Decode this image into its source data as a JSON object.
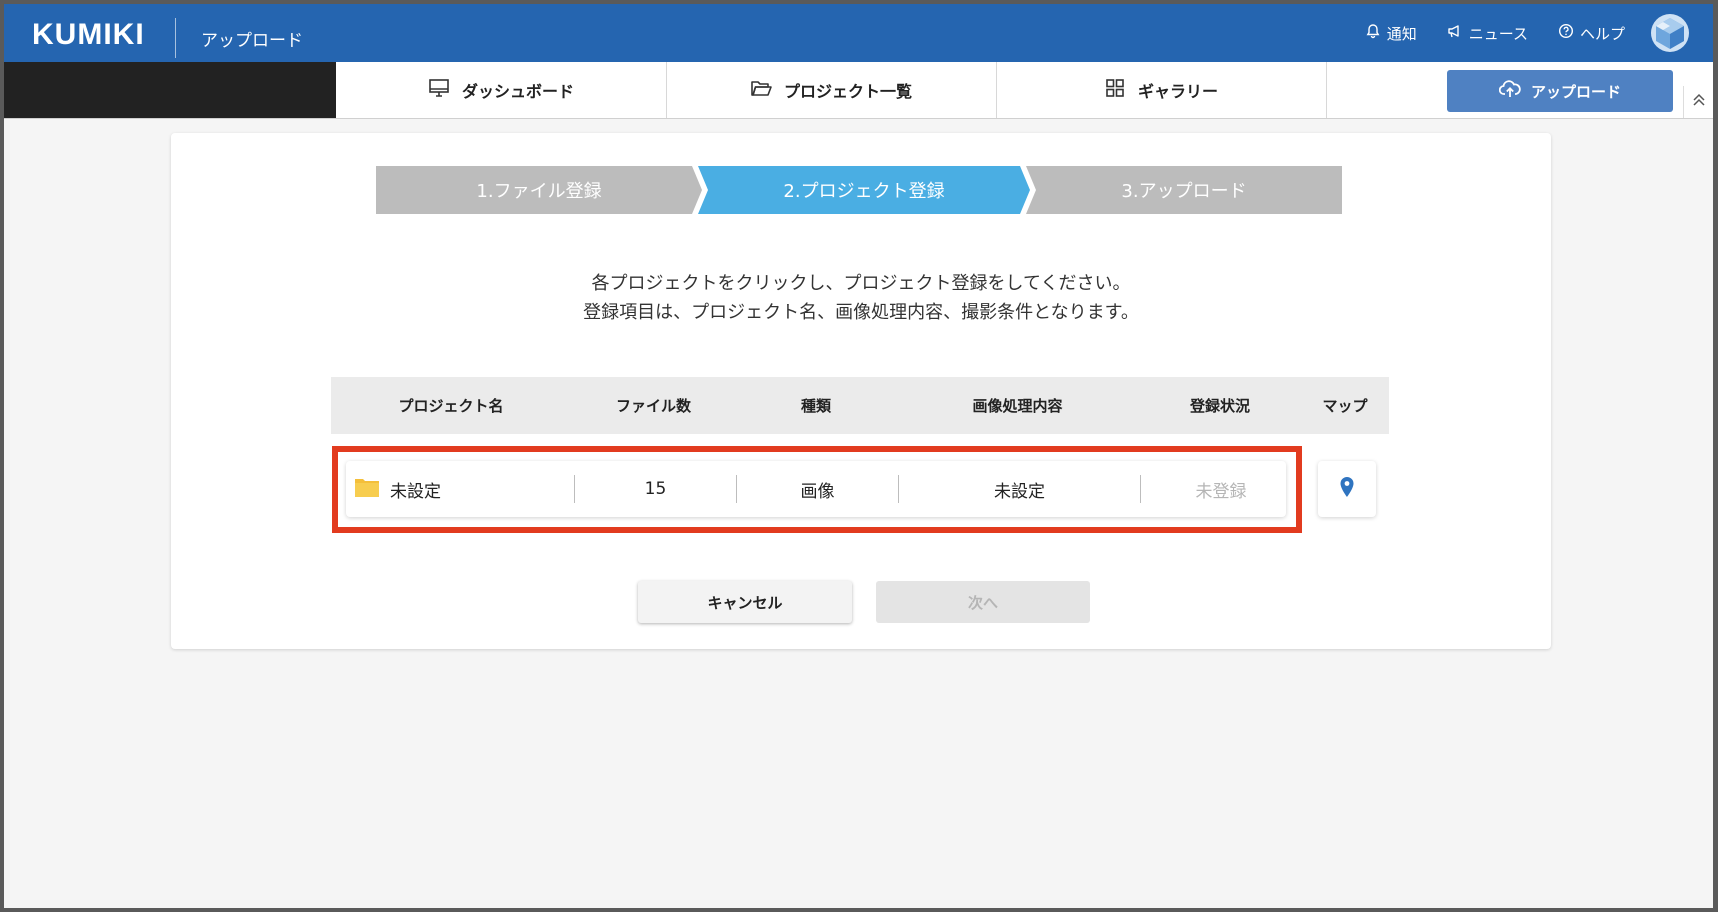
{
  "header": {
    "logo": "KUMIKI",
    "page_name": "アップロード",
    "notify_label": "通知",
    "news_label": "ニュース",
    "help_label": "ヘルプ"
  },
  "nav": {
    "tabs": [
      {
        "label": "ダッシュボード",
        "icon": "monitor-icon"
      },
      {
        "label": "プロジェクト一覧",
        "icon": "folder-icon"
      },
      {
        "label": "ギャラリー",
        "icon": "grid-icon"
      }
    ],
    "upload_label": "アップロード"
  },
  "steps": [
    {
      "label": "1.ファイル登録",
      "active": false
    },
    {
      "label": "2.プロジェクト登録",
      "active": true
    },
    {
      "label": "3.アップロード",
      "active": false
    }
  ],
  "instructions": {
    "line1": "各プロジェクトをクリックし、プロジェクト登録をしてください。",
    "line2": "登録項目は、プロジェクト名、画像処理内容、撮影条件となります。"
  },
  "table": {
    "headers": {
      "name": "プロジェクト名",
      "files": "ファイル数",
      "type": "種類",
      "processing": "画像処理内容",
      "status": "登録状況",
      "map": "マップ"
    },
    "rows": [
      {
        "name": "未設定",
        "files": "15",
        "type": "画像",
        "processing": "未設定",
        "status": "未登録"
      }
    ]
  },
  "buttons": {
    "cancel": "キャンセル",
    "next": "次へ"
  },
  "colors": {
    "header_bg": "#2565b0",
    "step_active": "#4aaee3",
    "step_inactive": "#bcbcbc",
    "highlight": "#e23b1f",
    "upload_btn": "#4f81c2"
  }
}
